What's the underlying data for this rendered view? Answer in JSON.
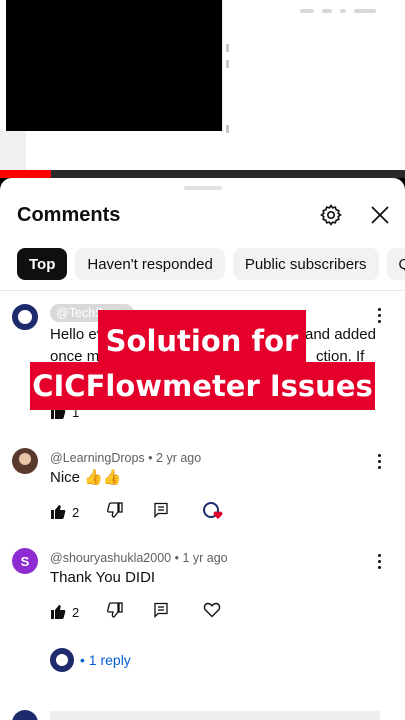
{
  "video": {
    "progress_fraction": 0.125,
    "accent": "#ff0000"
  },
  "overlay": {
    "line1": "Solution for",
    "line2": "CICFlowmeter Issues"
  },
  "sheet": {
    "title": "Comments",
    "settings_icon": "gear-icon",
    "close_icon": "close-icon",
    "chips": [
      "Top",
      "Haven't responded",
      "Public subscribers",
      "Q"
    ]
  },
  "comments": [
    {
      "author": "@TechS",
      "text_visible_left": "Hello ev",
      "text_visible_right": "and added",
      "text2_left": "once m",
      "text2_right": "ction. If",
      "likes": "1",
      "avatar_color": "#1e2a6b"
    },
    {
      "author": "@LearningDrops",
      "meta": "• 2 yr ago",
      "text": "Nice 👍👍",
      "likes": "2",
      "avatar_color": "#5a3a2e"
    },
    {
      "author": "@shouryashukla2000",
      "meta": "• 1 yr ago",
      "text": "Thank You DIDI",
      "likes": "2",
      "avatar_letter": "S",
      "avatar_color": "#8e2bd1"
    }
  ],
  "replies": {
    "label": "• 1 reply"
  }
}
